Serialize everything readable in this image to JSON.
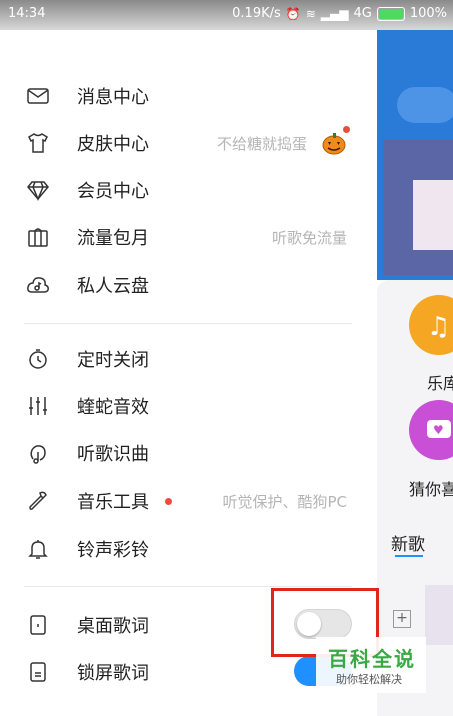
{
  "status_bar": {
    "time": "14:34",
    "speed": "0.19K/s",
    "network": "4G",
    "battery": "100%"
  },
  "menu": {
    "group1": [
      {
        "label": "消息中心",
        "icon": "mail-icon"
      },
      {
        "label": "皮肤中心",
        "icon": "tshirt-icon",
        "hint": "不给糖就捣蛋"
      },
      {
        "label": "会员中心",
        "icon": "diamond-icon"
      },
      {
        "label": "流量包月",
        "icon": "gift-icon",
        "hint": "听歌免流量"
      },
      {
        "label": "私人云盘",
        "icon": "cloud-music-icon"
      }
    ],
    "group2": [
      {
        "label": "定时关闭",
        "icon": "timer-icon"
      },
      {
        "label": "蝰蛇音效",
        "icon": "equalizer-icon"
      },
      {
        "label": "听歌识曲",
        "icon": "recognize-music-icon"
      },
      {
        "label": "音乐工具",
        "icon": "wrench-icon",
        "hint": "听觉保护、酷狗PC"
      },
      {
        "label": "铃声彩铃",
        "icon": "bell-icon"
      }
    ],
    "group3": [
      {
        "label": "桌面歌词",
        "icon": "desktop-lyrics-icon",
        "toggle": "off"
      },
      {
        "label": "锁屏歌词",
        "icon": "lockscreen-lyrics-icon",
        "toggle": "on"
      }
    ]
  },
  "background_app": {
    "item1": "乐库",
    "item2": "猜你喜",
    "section": "新歌"
  },
  "watermark": {
    "title": "百科全说",
    "subtitle": "助你轻松解决"
  },
  "colors": {
    "accent_blue": "#1e90ff",
    "highlight_red": "#e0261b",
    "notification_red": "#e84c3d",
    "watermark_green": "#3aa844"
  }
}
